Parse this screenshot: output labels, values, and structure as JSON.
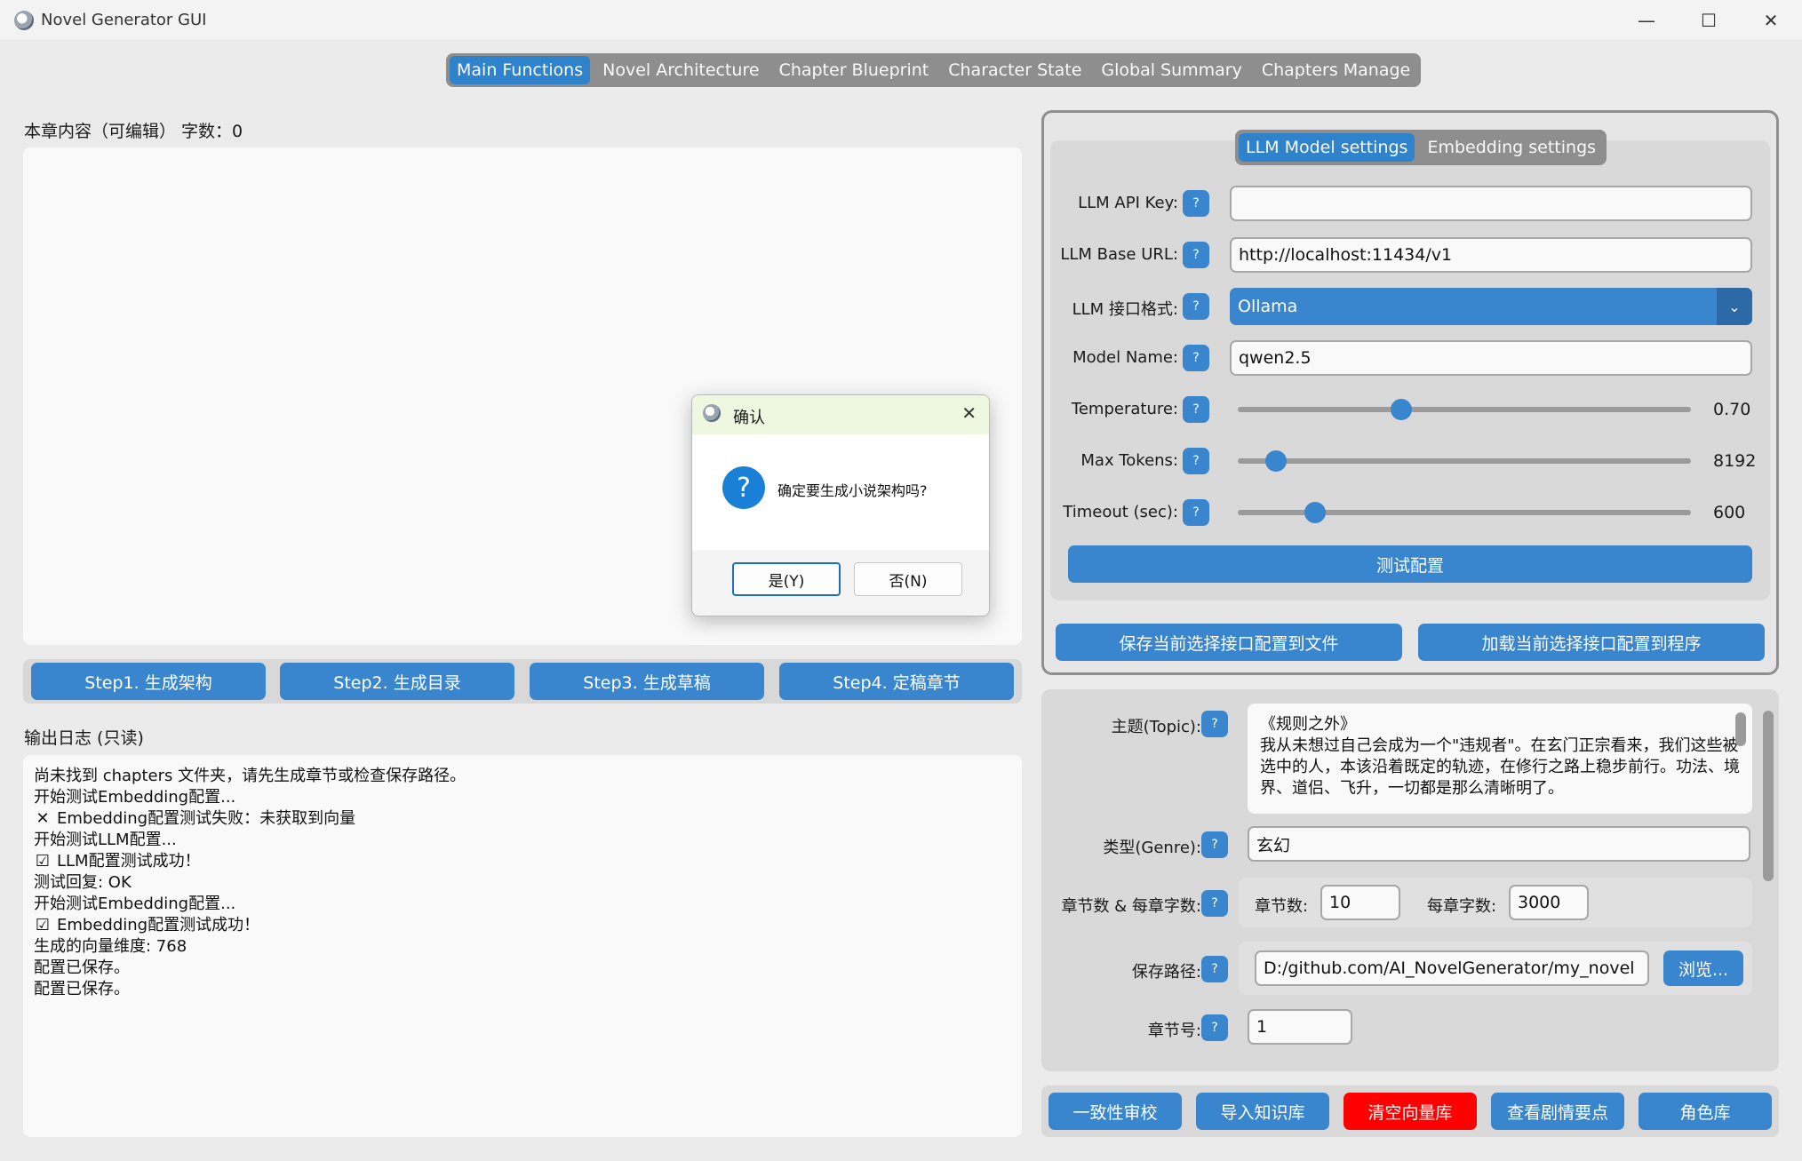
{
  "window": {
    "title": "Novel Generator GUI",
    "minimize": "—",
    "maximize": "☐",
    "close": "✕"
  },
  "tabs": [
    {
      "label": "Main Functions",
      "active": true
    },
    {
      "label": "Novel Architecture"
    },
    {
      "label": "Chapter Blueprint"
    },
    {
      "label": "Character State"
    },
    {
      "label": "Global Summary"
    },
    {
      "label": "Chapters Manage"
    }
  ],
  "editor": {
    "label": "本章内容（可编辑） 字数：0",
    "content": ""
  },
  "steps": [
    "Step1. 生成架构",
    "Step2. 生成目录",
    "Step3. 生成草稿",
    "Step4. 定稿章节"
  ],
  "log": {
    "label": "输出日志 (只读)",
    "lines": [
      {
        "mark": "",
        "text": "尚未找到 chapters 文件夹，请先生成章节或检查保存路径。"
      },
      {
        "mark": "",
        "text": "开始测试Embedding配置..."
      },
      {
        "mark": "✕",
        "text": "Embedding配置测试失败：未获取到向量"
      },
      {
        "mark": "",
        "text": "开始测试LLM配置..."
      },
      {
        "mark": "☑",
        "text": "LLM配置测试成功！"
      },
      {
        "mark": "",
        "text": "测试回复: OK"
      },
      {
        "mark": "",
        "text": "开始测试Embedding配置..."
      },
      {
        "mark": "☑",
        "text": "Embedding配置测试成功！"
      },
      {
        "mark": "",
        "text": "生成的向量维度: 768"
      },
      {
        "mark": "",
        "text": "配置已保存。"
      },
      {
        "mark": "",
        "text": "配置已保存。"
      }
    ]
  },
  "settings": {
    "subtabs": [
      {
        "label": "LLM Model settings",
        "active": true
      },
      {
        "label": "Embedding settings"
      }
    ],
    "help": "?",
    "api_key": {
      "label": "LLM API Key:",
      "value": ""
    },
    "base_url": {
      "label": "LLM Base URL:",
      "value": "http://localhost:11434/v1"
    },
    "interface": {
      "label": "LLM 接口格式:",
      "value": "Ollama"
    },
    "model": {
      "label": "Model Name:",
      "value": "qwen2.5"
    },
    "temperature": {
      "label": "Temperature:",
      "value": "0.70",
      "fraction": 0.36
    },
    "max_tokens": {
      "label": "Max Tokens:",
      "value": "8192",
      "fraction": 0.085
    },
    "timeout": {
      "label": "Timeout (sec):",
      "value": "600",
      "fraction": 0.17
    },
    "test_button": "测试配置",
    "save_button": "保存当前选择接口配置到文件",
    "load_button": "加载当前选择接口配置到程序"
  },
  "novel": {
    "topic_label": "主题(Topic):",
    "topic_text": "《规则之外》\n我从未想过自己会成为一个\"违规者\"。在玄门正宗看来，我们这些被选中的人，本该沿着既定的轨迹，在修行之路上稳步前行。功法、境界、道侣、飞升，一切都是那么清晰明了。",
    "genre_label": "类型(Genre):",
    "genre_value": "玄幻",
    "chapters_label": "章节数 & 每章字数:",
    "chapter_count_label": "章节数:",
    "chapter_count_value": "10",
    "words_label": "每章字数:",
    "words_value": "3000",
    "path_label": "保存路径:",
    "path_value": "D:/github.com/AI_NovelGenerator/my_novel",
    "browse_button": "浏览...",
    "chapter_no_label": "章节号:",
    "chapter_no_value": "1"
  },
  "bottom_buttons": [
    "一致性审校",
    "导入知识库",
    "清空向量库",
    "查看剧情要点",
    "角色库"
  ],
  "dialog": {
    "title": "确认",
    "message": "确定要生成小说架构吗?",
    "yes": "是(Y)",
    "no": "否(N)",
    "close": "✕",
    "question_glyph": "?"
  },
  "colors": {
    "accent": "#3a86ce",
    "danger": "#ff0000",
    "tab_bg": "#8e8e8e"
  }
}
